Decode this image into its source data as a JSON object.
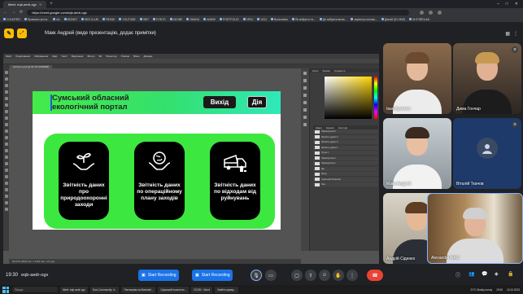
{
  "browser": {
    "tab_title": "Meet: eqb-aedr-ogx",
    "url": "https://meet.google.com/eqb-aedr-ogx",
    "bookmarks": [
      "COUNTER",
      "Правила гри на..",
      "AA",
      "MONEY",
      "SBS CLUB",
      "FRANK",
      "YOUTUBE",
      "ЗВІТ",
      "FONTS",
      "ADOBE",
      "ЗМАНА",
      "ANIME",
      "PORTFOLIO",
      "VRSJ",
      "VA11",
      "Bookmarks",
      "Як вибрати та...",
      "Де вибрати вікна...",
      "зареєстр-кнопки...",
      "Дізнай (ID-VMS)",
      "АНГЛІЙСЬКА"
    ]
  },
  "meet": {
    "presenting_label": "Макк Андрей (веде презентацію, додає примітки)",
    "time": "19:30",
    "meeting_code": "eqb-aedr-ogx",
    "record_buttons": [
      "Start Recording",
      "Start Recording"
    ]
  },
  "photoshop": {
    "menu": [
      "Файл",
      "Редагування",
      "Зображення",
      "Шар",
      "Текст",
      "Виділення",
      "Фільтр",
      "3D",
      "Перегляд",
      "Плагіни",
      "Вікно",
      "Довідка"
    ],
    "doc_tab": "звітність.psd @ 66,7% (RGB/8#)",
    "status": "66,67%   3840 пікс. x 2160 пікс. (72 ppi)",
    "panel_tabs": [
      "Колір",
      "Зразки",
      "Градієнти"
    ],
    "layers_tabs": [
      "Шари",
      "Канали",
      "Контури"
    ],
    "layers": [
      "Прямокутник 3",
      "Звітність даних 3",
      "Звітність даних 2",
      "Звітність даних 1",
      "Група 1",
      "Прямокутник 2",
      "Прямокутник 1",
      "Дія",
      "Вихід",
      "Сумський обласний",
      "Фон"
    ]
  },
  "canvas": {
    "title_line1": "Сумський обласний",
    "title_line2": "екологічний портал",
    "exit_label": "Вихід",
    "action_label": "Дія",
    "cards": [
      {
        "caption": "Звітність даних про природоохоронні заходи"
      },
      {
        "caption": "Звітність даних по операційному плану заходів"
      },
      {
        "caption": "Звітність даних по відходам від руйнувань"
      }
    ],
    "colors": {
      "green": "#3ce83f",
      "teal": "#2fe8b9",
      "card": "#000000"
    }
  },
  "participants": [
    {
      "name": "Іван Бусенко"
    },
    {
      "name": "Дима Гончар"
    },
    {
      "name": "Макк Андрей"
    },
    {
      "name": "Віталій Ткачов"
    },
    {
      "name": "Андрій Сіденко"
    },
    {
      "name": "Alexander NAU"
    }
  ],
  "taskbar": {
    "search": "Пошук",
    "items": [
      "Meet: eqb-aedr-ogx",
      "Ecol-Community: d...",
      "Пентаграм на Marshall...",
      "Сумський екологічн...",
      "ZOOM - Word",
      "Знайти цікаву..."
    ],
    "weather": "21°C  Mostly sunny",
    "clock": "19:30",
    "date": "15.10.2023"
  }
}
